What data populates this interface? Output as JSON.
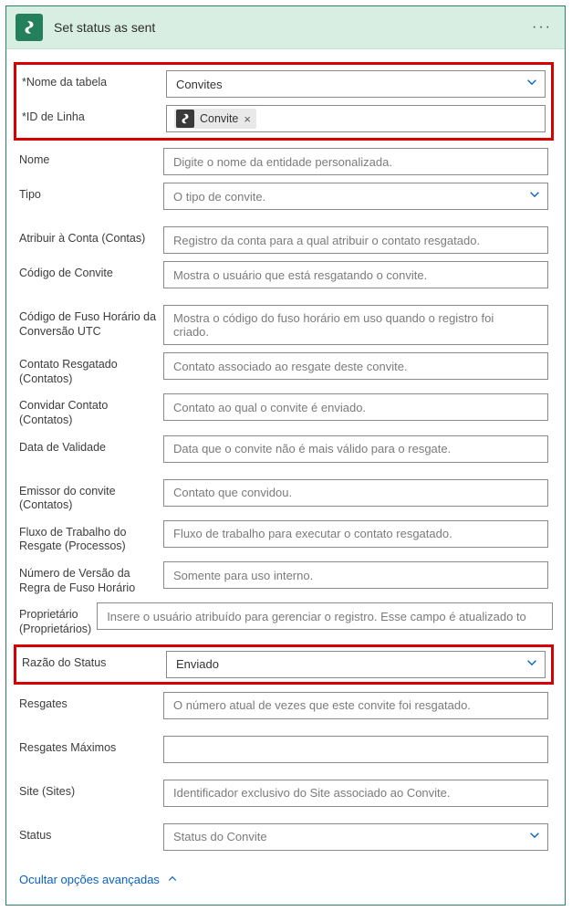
{
  "header": {
    "title": "Set status as sent",
    "menu": "···"
  },
  "group1": {
    "table": {
      "label": "Nome da tabela",
      "value": "Convites",
      "required": true
    },
    "rowId": {
      "label": "ID de Linha",
      "chip": "Convite",
      "required": true
    }
  },
  "fields": {
    "nome": {
      "label": "Nome",
      "ph": "Digite o nome da entidade personalizada."
    },
    "tipo": {
      "label": "Tipo",
      "ph": "O tipo de convite."
    },
    "atribuir": {
      "label": "Atribuir à Conta (Contas)",
      "ph": "Registro da conta para a qual atribuir o contato resgatado."
    },
    "codigo": {
      "label": "Código de Convite",
      "ph": "Mostra o usuário que está resgatando o convite."
    },
    "fuso": {
      "label": "Código de Fuso Horário da Conversão UTC",
      "ph": "Mostra o código do fuso horário em uso quando o registro foi criado."
    },
    "contatoRes": {
      "label": "Contato Resgatado (Contatos)",
      "ph": "Contato associado ao resgate deste convite."
    },
    "convidar": {
      "label": "Convidar Contato (Contatos)",
      "ph": "Contato ao qual o convite é enviado."
    },
    "validade": {
      "label": "Data de Validade",
      "ph": "Data que o convite não é mais válido para o resgate."
    },
    "emissor": {
      "label": "Emissor do convite (Contatos)",
      "ph": "Contato que convidou."
    },
    "fluxo": {
      "label": "Fluxo de Trabalho do Resgate (Processos)",
      "ph": "Fluxo de trabalho para executar o contato resgatado."
    },
    "versao": {
      "label": "Número de Versão da Regra de Fuso Horário",
      "ph": "Somente para uso interno."
    },
    "prop": {
      "label": "Proprietário (Proprietários)",
      "ph": "Insere o usuário atribuído para gerenciar o registro. Esse campo é atualizado to"
    },
    "razao": {
      "label": "Razão do Status",
      "value": "Enviado"
    },
    "resgates": {
      "label": "Resgates",
      "ph": "O número atual de vezes que este convite foi resgatado."
    },
    "resgatesMax": {
      "label": "Resgates Máximos",
      "ph": ""
    },
    "site": {
      "label": "Site (Sites)",
      "ph": "Identificador exclusivo do Site associado ao Convite."
    },
    "status": {
      "label": "Status",
      "ph": "Status do Convite"
    }
  },
  "toggle": {
    "label": "Ocultar opções avançadas"
  }
}
